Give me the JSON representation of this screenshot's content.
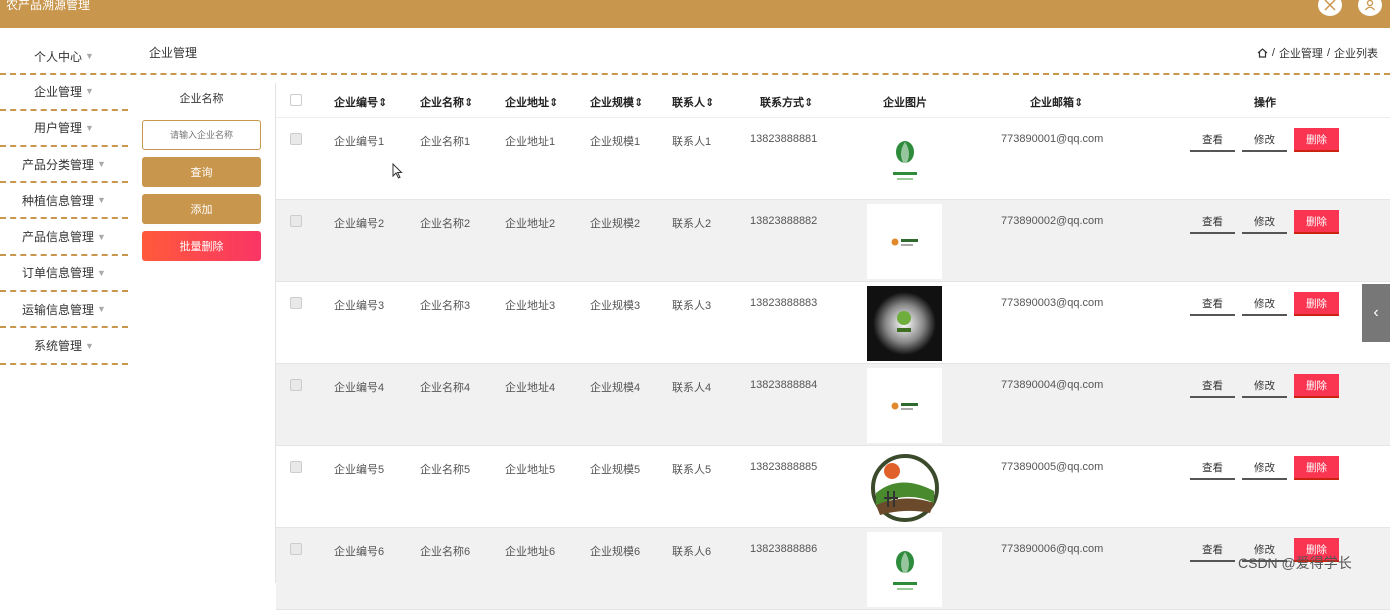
{
  "app": {
    "title": "农产品溯源管理"
  },
  "sidebar": {
    "items": [
      {
        "label": "个人中心"
      },
      {
        "label": "企业管理"
      },
      {
        "label": "用户管理"
      },
      {
        "label": "产品分类管理"
      },
      {
        "label": "种植信息管理"
      },
      {
        "label": "产品信息管理"
      },
      {
        "label": "订单信息管理"
      },
      {
        "label": "运输信息管理"
      },
      {
        "label": "系统管理"
      }
    ]
  },
  "header": {
    "page_title": "企业管理",
    "breadcrumb": [
      "企业管理",
      "企业列表"
    ]
  },
  "search": {
    "label": "企业名称",
    "placeholder": "请输入企业名称",
    "query_label": "查询",
    "add_label": "添加",
    "batch_delete_label": "批量删除"
  },
  "table": {
    "columns": [
      "企业编号",
      "企业名称",
      "企业地址",
      "企业规模",
      "联系人",
      "联系方式",
      "企业图片",
      "企业邮箱",
      "操作"
    ],
    "sortable": [
      "企业编号",
      "企业名称",
      "企业地址",
      "企业规模",
      "联系人",
      "联系方式",
      "企业邮箱"
    ],
    "rows": [
      {
        "code": "企业编号1",
        "name": "企业名称1",
        "addr": "企业地址1",
        "scale": "企业规模1",
        "contact": "联系人1",
        "phone": "13823888881",
        "email": "773890001@qq.com",
        "image_icon": "green-leaf-logo"
      },
      {
        "code": "企业编号2",
        "name": "企业名称2",
        "addr": "企业地址2",
        "scale": "企业规模2",
        "contact": "联系人2",
        "phone": "13823888882",
        "email": "773890002@qq.com",
        "image_icon": "small-logo"
      },
      {
        "code": "企业编号3",
        "name": "企业名称3",
        "addr": "企业地址3",
        "scale": "企业规模3",
        "contact": "联系人3",
        "phone": "13823888883",
        "email": "773890003@qq.com",
        "image_icon": "dark-glow-logo"
      },
      {
        "code": "企业编号4",
        "name": "企业名称4",
        "addr": "企业地址4",
        "scale": "企业规模4",
        "contact": "联系人4",
        "phone": "13823888884",
        "email": "773890004@qq.com",
        "image_icon": "small-logo"
      },
      {
        "code": "企业编号5",
        "name": "企业名称5",
        "addr": "企业地址5",
        "scale": "企业规模5",
        "contact": "联系人5",
        "phone": "13823888885",
        "email": "773890005@qq.com",
        "image_icon": "farm-circle-logo"
      },
      {
        "code": "企业编号6",
        "name": "企业名称6",
        "addr": "企业地址6",
        "scale": "企业规模6",
        "contact": "联系人6",
        "phone": "13823888886",
        "email": "773890006@qq.com",
        "image_icon": "green-leaf-logo"
      }
    ],
    "actions": {
      "view": "查看",
      "edit": "修改",
      "delete": "删除"
    }
  },
  "watermark": "CSDN @爱得学长",
  "colors": {
    "accent": "#c8964c",
    "danger": "#f93552"
  }
}
